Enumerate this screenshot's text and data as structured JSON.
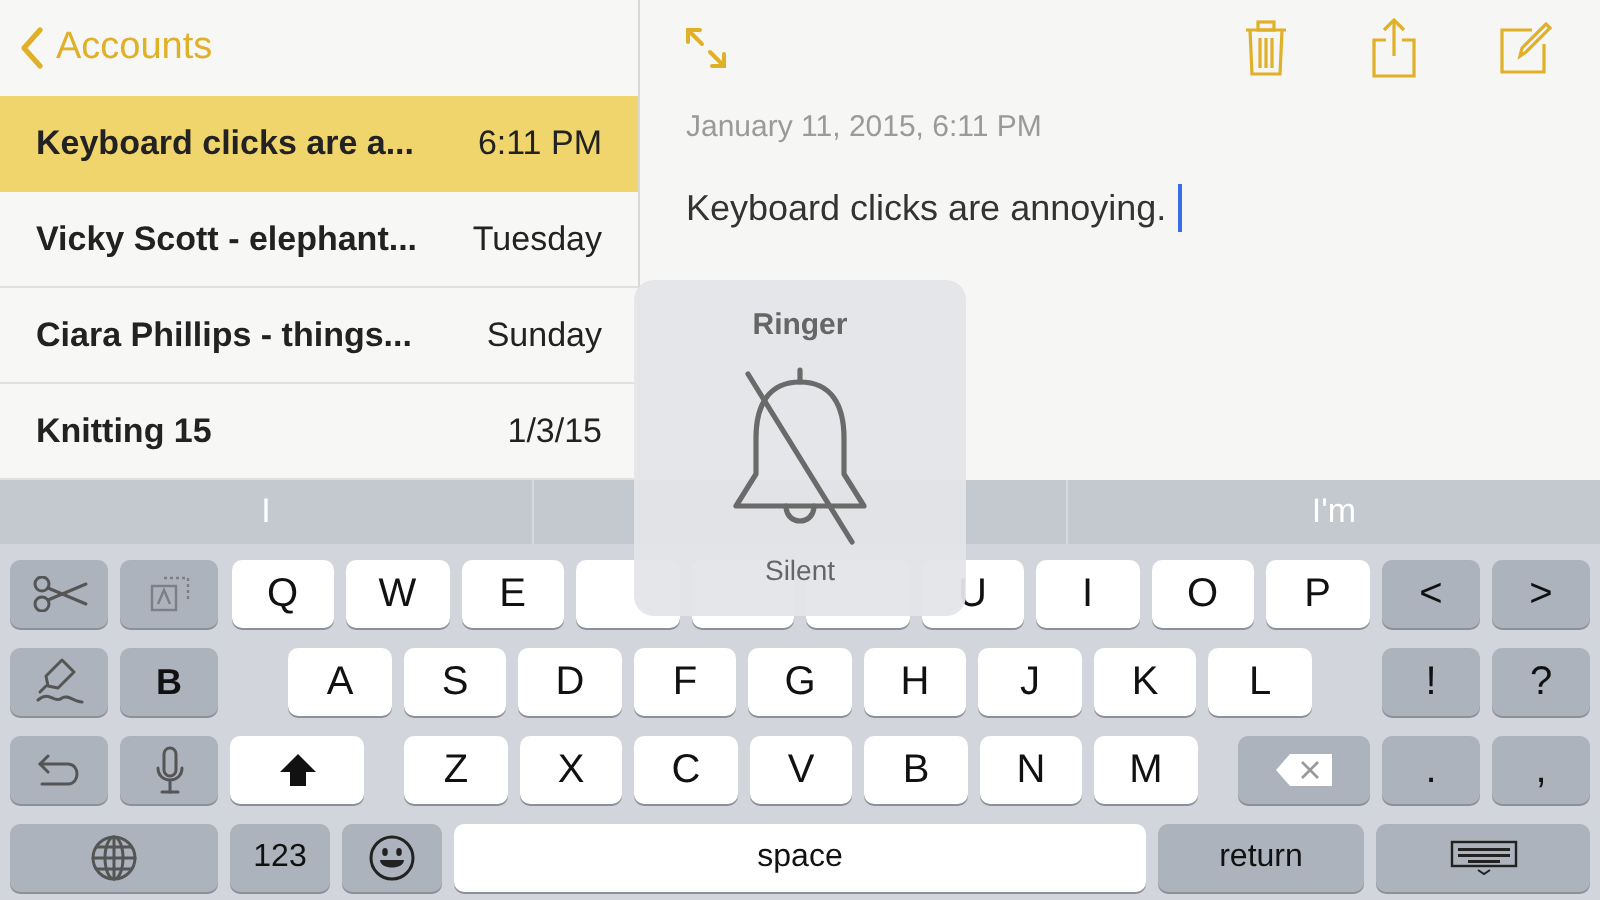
{
  "sidebar": {
    "back_label": "Accounts",
    "notes": [
      {
        "title": "Keyboard clicks are a...",
        "date": "6:11 PM",
        "selected": true
      },
      {
        "title": "Vicky Scott - elephant...",
        "date": "Tuesday",
        "selected": false
      },
      {
        "title": "Ciara Phillips - things...",
        "date": "Sunday",
        "selected": false
      },
      {
        "title": "Knitting 15",
        "date": "1/3/15",
        "selected": false
      }
    ]
  },
  "note": {
    "date": "January 11, 2015, 6:11 PM",
    "text": "Keyboard clicks are annoying."
  },
  "hud": {
    "title": "Ringer",
    "status": "Silent"
  },
  "keyboard": {
    "suggestions": {
      "left": "I",
      "right": "I'm"
    },
    "rows": [
      {
        "left": [
          {
            "kind": "cut"
          },
          {
            "kind": "text-style"
          }
        ],
        "middle": [
          {
            "kind": "letter",
            "label": "Q"
          },
          {
            "kind": "letter",
            "label": "W"
          },
          {
            "kind": "letter",
            "label": "E"
          },
          {
            "kind": "blank"
          },
          {
            "kind": "blank"
          },
          {
            "kind": "blank"
          },
          {
            "kind": "letter",
            "label": "U"
          },
          {
            "kind": "letter",
            "label": "I"
          },
          {
            "kind": "letter",
            "label": "O"
          },
          {
            "kind": "letter",
            "label": "P"
          }
        ],
        "right": [
          {
            "kind": "symbol",
            "label": "<"
          },
          {
            "kind": "symbol",
            "label": ">"
          }
        ]
      },
      {
        "left": [
          {
            "kind": "paste"
          },
          {
            "kind": "bold",
            "label": "B"
          }
        ],
        "middle": [
          {
            "kind": "letter",
            "label": "A"
          },
          {
            "kind": "letter",
            "label": "S"
          },
          {
            "kind": "letter",
            "label": "D"
          },
          {
            "kind": "letter",
            "label": "F"
          },
          {
            "kind": "letter",
            "label": "G"
          },
          {
            "kind": "letter",
            "label": "H"
          },
          {
            "kind": "letter",
            "label": "J"
          },
          {
            "kind": "letter",
            "label": "K"
          },
          {
            "kind": "letter",
            "label": "L"
          }
        ],
        "right": [
          {
            "kind": "symbol",
            "label": "!"
          },
          {
            "kind": "symbol",
            "label": "?"
          }
        ]
      },
      {
        "left": [
          {
            "kind": "undo"
          },
          {
            "kind": "dictation"
          },
          {
            "kind": "shift"
          }
        ],
        "middle": [
          {
            "kind": "letter",
            "label": "Z"
          },
          {
            "kind": "letter",
            "label": "X"
          },
          {
            "kind": "letter",
            "label": "C"
          },
          {
            "kind": "letter",
            "label": "V"
          },
          {
            "kind": "letter",
            "label": "B"
          },
          {
            "kind": "letter",
            "label": "N"
          },
          {
            "kind": "letter",
            "label": "M"
          }
        ],
        "right": [
          {
            "kind": "delete"
          },
          {
            "kind": "symbol",
            "label": "."
          },
          {
            "kind": "symbol",
            "label": ","
          }
        ]
      },
      {
        "left": [
          {
            "kind": "globe"
          },
          {
            "kind": "numbers",
            "label": "123"
          },
          {
            "kind": "emoji"
          }
        ],
        "middle": [
          {
            "kind": "space",
            "label": "space"
          }
        ],
        "right": [
          {
            "kind": "return",
            "label": "return"
          },
          {
            "kind": "hide-keyboard"
          }
        ]
      }
    ]
  }
}
